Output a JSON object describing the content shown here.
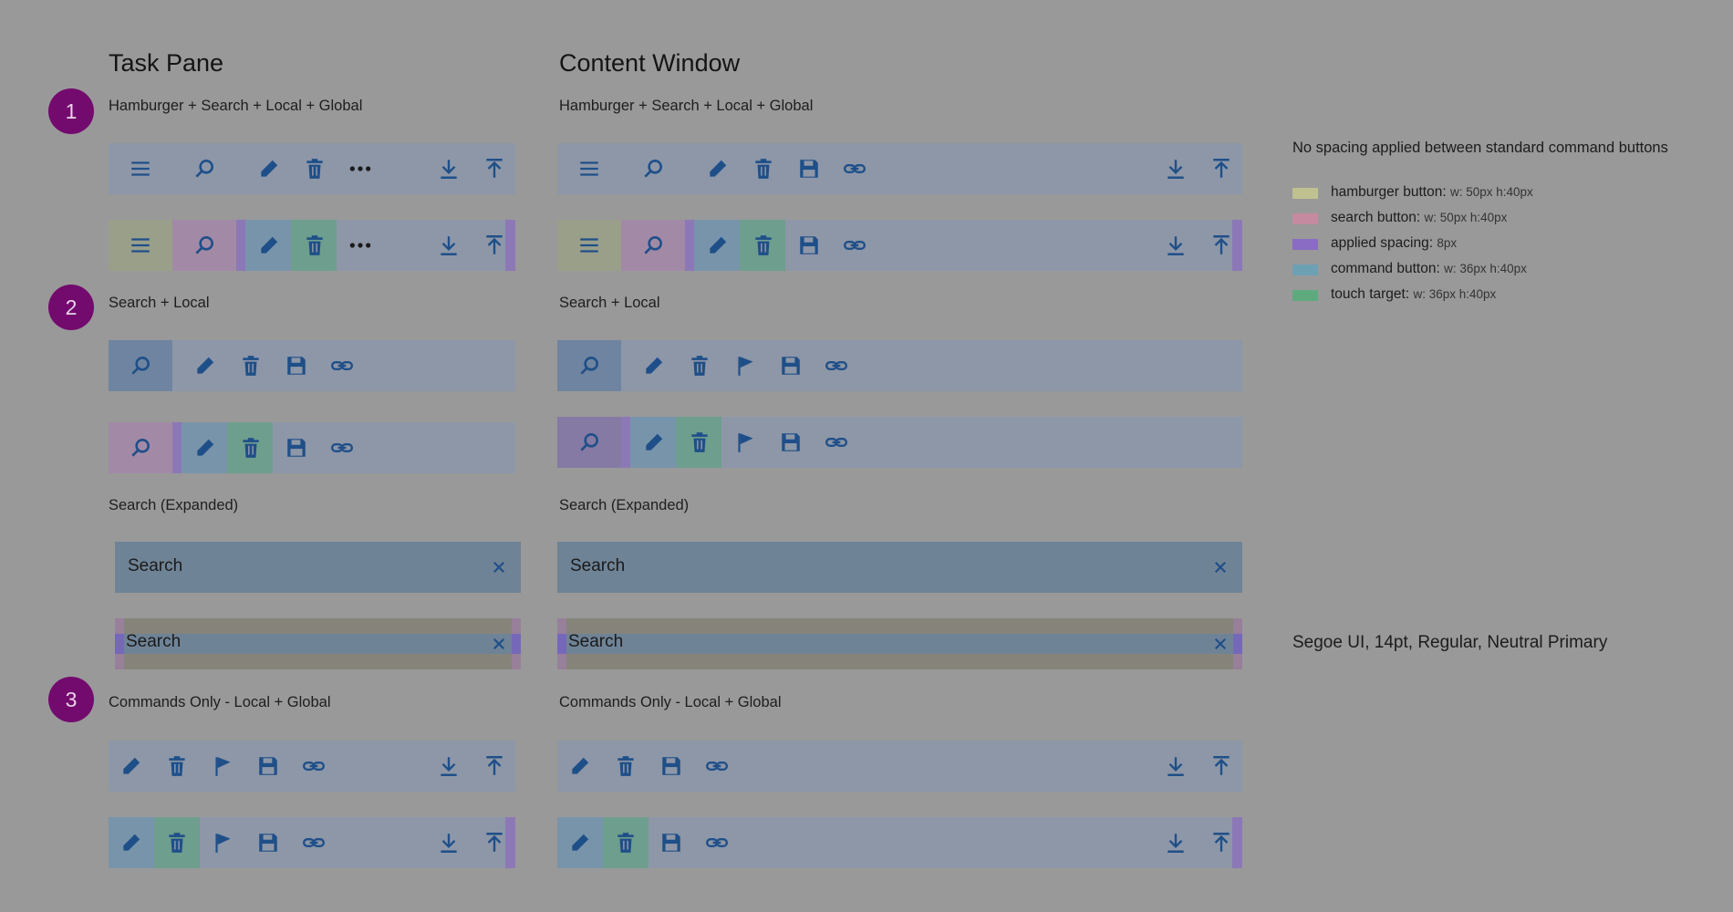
{
  "columns": {
    "task_pane": "Task Pane",
    "content_window": "Content Window"
  },
  "badges": [
    "1",
    "2",
    "3"
  ],
  "sections": {
    "s1": "Hamburger + Search + Local + Global",
    "s2": "Search + Local",
    "s2b": "Search (Expanded)",
    "s3": "Commands Only - Local + Global"
  },
  "search_placeholder": "Search",
  "notes": {
    "no_spacing": "No spacing applied between standard command buttons",
    "font": "Segoe UI, 14pt, Regular, Neutral Primary"
  },
  "legend": [
    {
      "name": "hamburger button:",
      "dims": "w: 50px h:40px",
      "color": "#bfc290"
    },
    {
      "name": "search button:",
      "dims": "w: 50px h:40px",
      "color": "#c58aa0"
    },
    {
      "name": "applied spacing:",
      "dims": "8px",
      "color": "#8a6cc4"
    },
    {
      "name": "command button:",
      "dims": "w: 36px h:40px",
      "color": "#6ea0b4"
    },
    {
      "name": "touch target:",
      "dims": "w: 36px h:40px",
      "color": "#5eaa7e"
    }
  ],
  "icons": {
    "hamburger": "hamburger-icon",
    "search": "search-icon",
    "edit": "pencil-icon",
    "delete": "trash-icon",
    "more": "more-icon",
    "save": "save-icon",
    "link": "link-icon",
    "flag": "flag-icon",
    "download": "download-icon",
    "upload": "upload-icon",
    "close": "close-icon"
  },
  "colors": {
    "background": "#999999",
    "bar": "#8d97a8",
    "icon": "#1f4f88",
    "badge": "#730a6e"
  }
}
